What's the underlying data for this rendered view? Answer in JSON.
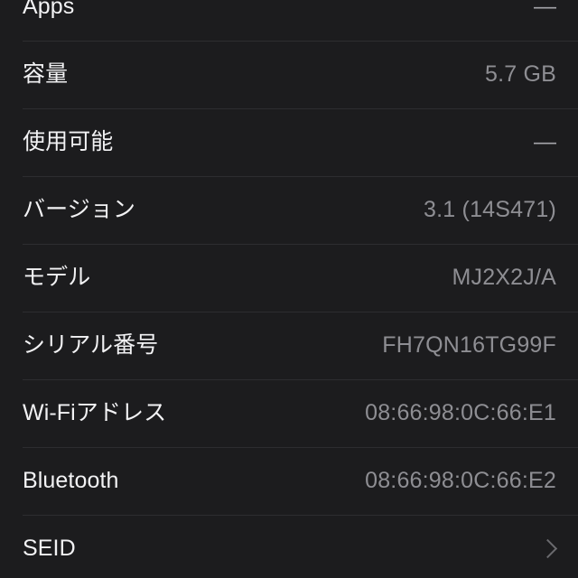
{
  "screen": {
    "background_color": "#1c1c1e",
    "label_color": "#f2f2f4",
    "value_color": "#8e8e93",
    "separator_color": "#2d2d30"
  },
  "info_list": {
    "rows": [
      {
        "label": "Apps",
        "value": "—",
        "icon": "",
        "value_style": "dash"
      },
      {
        "label": "容量",
        "value": "5.7 GB",
        "icon": "",
        "value_style": "text"
      },
      {
        "label": "使用可能",
        "value": "—",
        "icon": "",
        "value_style": "dash"
      },
      {
        "label": "バージョン",
        "value": "3.1 (14S471)",
        "icon": "",
        "value_style": "text"
      },
      {
        "label": "モデル",
        "value": "MJ2X2J/A",
        "icon": "",
        "value_style": "text"
      },
      {
        "label": "シリアル番号",
        "value": "FH7QN16TG99F",
        "icon": "",
        "value_style": "text"
      },
      {
        "label": "Wi-Fiアドレス",
        "value": "08:66:98:0C:66:E1",
        "icon": "",
        "value_style": "text"
      },
      {
        "label": "Bluetooth",
        "value": "08:66:98:0C:66:E2",
        "icon": "",
        "value_style": "text"
      },
      {
        "label": "SEID",
        "value": "",
        "icon": "chevron-right-icon",
        "value_style": "text"
      }
    ]
  }
}
